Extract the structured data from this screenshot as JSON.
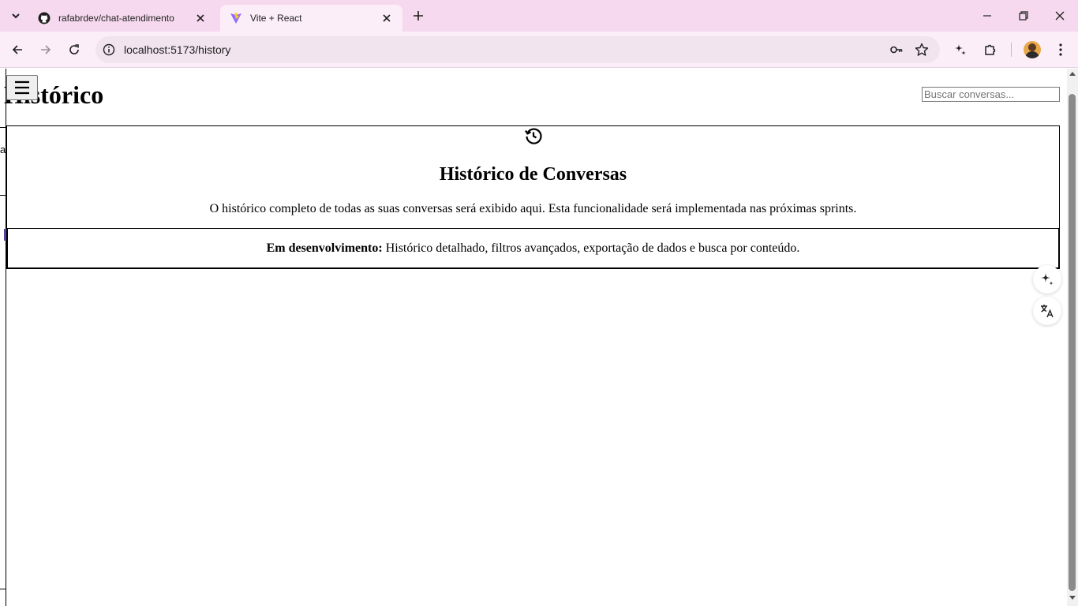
{
  "browser": {
    "tabs": [
      {
        "title": "rafabrdev/chat-atendimento",
        "icon": "github-icon",
        "active": false
      },
      {
        "title": "Vite + React",
        "icon": "vite-icon",
        "active": true
      }
    ],
    "url": "localhost:5173/history",
    "colors": {
      "tabstrip": "#f6d9ee",
      "toolbar": "#fbeef8",
      "omnibox": "#f1e4ef"
    }
  },
  "page": {
    "title": "Histórico",
    "search_placeholder": "Buscar conversas...",
    "stub_letter": "a",
    "card": {
      "icon": "history-icon",
      "title": "Histórico de Conversas",
      "description": "O histórico completo de todas as suas conversas será exibido aqui. Esta funcionalidade será implementada nas próximas sprints."
    },
    "dev_notice": {
      "label": "Em desenvolvimento:",
      "text": "Histórico detalhado, filtros avançados, exportação de dados e busca por conteúdo."
    }
  }
}
